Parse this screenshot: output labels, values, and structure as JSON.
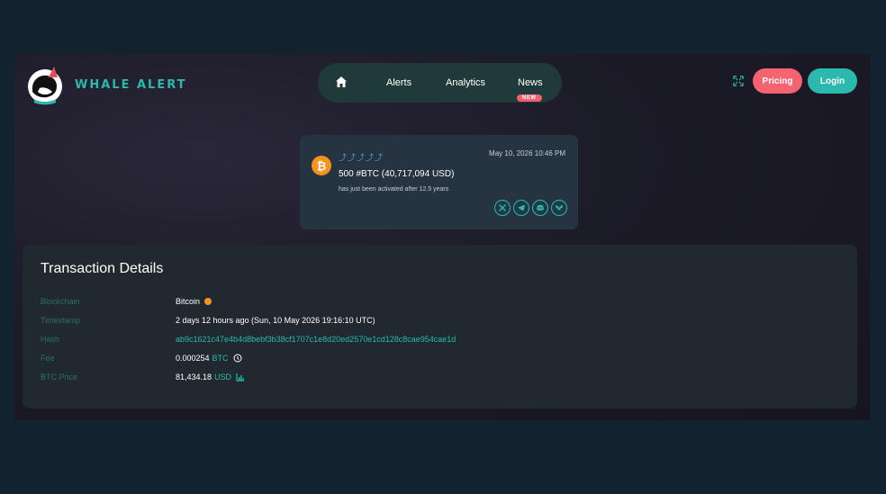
{
  "header": {
    "brand": "WHALE ALERT",
    "nav": {
      "alerts": "Alerts",
      "analytics": "Analytics",
      "news": "News",
      "news_badge": "NEW"
    },
    "pricing_label": "Pricing",
    "login_label": "Login"
  },
  "alert": {
    "whales": "⤴⤴⤴⤴⤴",
    "time": "May 10, 2026 10:46 PM",
    "amount": "500 #BTC (40,717,094 USD)",
    "note": "has just been activated after 12.5 years",
    "coin_symbol": "₿",
    "share_icons": [
      "x-icon",
      "telegram-icon",
      "discord-icon",
      "bluesky-icon"
    ]
  },
  "transaction": {
    "title": "Transaction Details",
    "rows": {
      "blockchain": {
        "label": "Blockchain",
        "value": "Bitcoin"
      },
      "timestamp": {
        "label": "Timestamp",
        "value": "2 days 12 hours ago (Sun, 10 May 2026 19:16:10 UTC)"
      },
      "hash": {
        "label": "Hash",
        "value": "ab9c1621c47e4b4d8bebf3b38cf1707c1e8d20ed2570e1cd128c8cae954cae1d"
      },
      "fee": {
        "label": "Fee",
        "value": "0.000254",
        "unit": "BTC"
      },
      "btc_price": {
        "label": "BTC Price",
        "value": "81,434.18",
        "unit": "USD"
      }
    }
  },
  "colors": {
    "accent": "#2bb8ae",
    "pricing": "#f46470",
    "bitcoin": "#f7931a",
    "background": "#12232f"
  }
}
